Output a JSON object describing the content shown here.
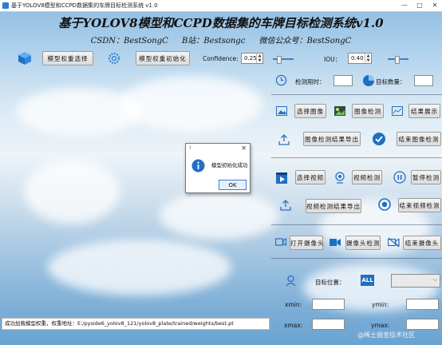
{
  "window": {
    "title": "基于YOLOV8模型和CCPD数据集的车牌目标检测系统 v1.0",
    "minimize": "—",
    "maximize": "□",
    "close": "✕"
  },
  "header": {
    "title": "基于YOLOV8模型和CCPD数据集的车牌目标检测系统v1.0",
    "csdn": "CSDN：BestSongC",
    "bilibili": "B站：Bestsongc",
    "wechat": "微信公众号：BestSongC"
  },
  "toolbar": {
    "select_model": "模型权重选择",
    "init_model": "模型权重初始化",
    "confidence_label": "Confidence:",
    "confidence_value": "0.25",
    "confidence_level": 0.25,
    "iou_label": "IOU：",
    "iou_value": "0.40",
    "iou_level": 0.4
  },
  "stats": {
    "time_label": "检测用时：",
    "time_value": "",
    "count_label": "目标数量：",
    "count_value": ""
  },
  "image_section": {
    "select_image": "选择图像",
    "detect_image": "图像检测",
    "show_result": "结果展示",
    "export_result": "图像检测结果导出",
    "end_detect": "结束图像检测"
  },
  "video_section": {
    "select_video": "选择视频",
    "detect_video": "视频检测",
    "pause_detect": "暂停检测",
    "export_result": "视频检测结果导出",
    "end_detect": "结束视频检测"
  },
  "camera_section": {
    "open_camera": "打开摄像头",
    "detect_camera": "摄像头检测",
    "close_camera": "结束摄像头"
  },
  "target": {
    "position_label": "目标位置：",
    "all_label": "ALL",
    "select_value": "",
    "xmin_label": "xmin:",
    "ymin_label": "ymin:",
    "xmax_label": "xmax:",
    "ymax_label": "ymax:",
    "xmin": "",
    "ymin": "",
    "xmax": "",
    "ymax": ""
  },
  "status": {
    "message": "成功加载模型权重，权重地址：E:/pyside6_yolov8_121/yolov8_plate/trained/weights/best.pt"
  },
  "dialog": {
    "title": "!",
    "close": "✕",
    "message": "模型初始化成功",
    "ok": "OK"
  },
  "watermark": "@稀土掘金技术社区",
  "colors": {
    "accent": "#2a7fd4",
    "slider": "#3b7fd1"
  }
}
